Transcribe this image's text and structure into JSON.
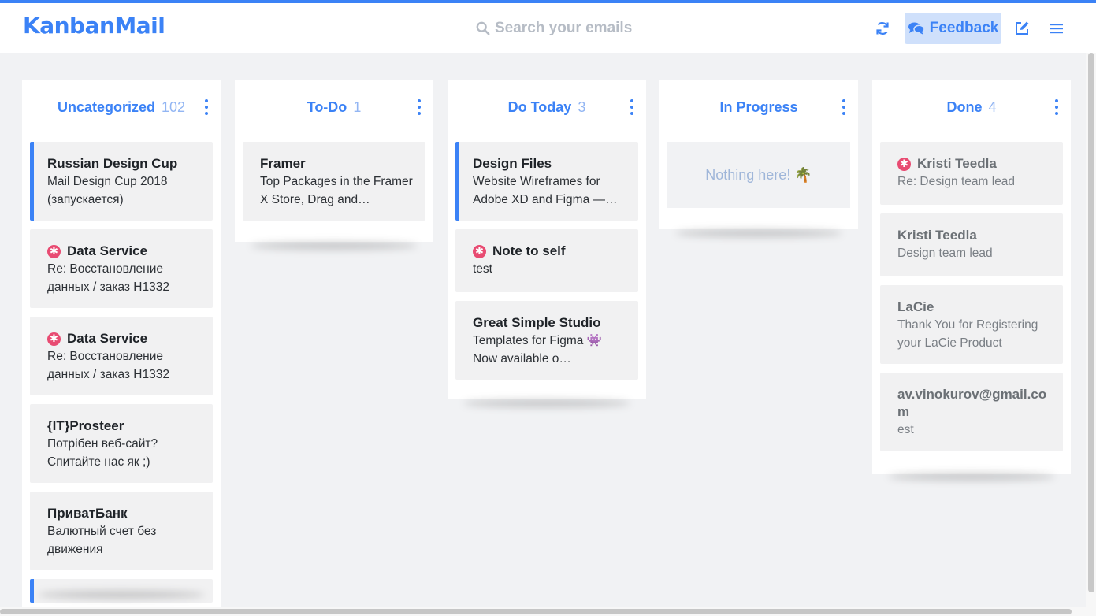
{
  "app": {
    "name": "KanbanMail",
    "accent_color": "#3b82f6"
  },
  "header": {
    "search_placeholder": "Search your emails",
    "feedback_label": "Feedback",
    "refresh_icon": "refresh-icon",
    "compose_icon": "compose-icon",
    "menu_icon": "hamburger-icon"
  },
  "columns": [
    {
      "title": "Uncategorized",
      "count": "102",
      "cards": [
        {
          "sender": "Russian Design Cup",
          "preview": "Mail Design Cup 2018 (запускается)",
          "important": false,
          "accent": true
        },
        {
          "sender": "Data Service",
          "preview": "Re: Восстановление данных / заказ H1332",
          "important": true,
          "accent": false
        },
        {
          "sender": "Data Service",
          "preview": "Re: Восстановление данных / заказ H1332",
          "important": true,
          "accent": false
        },
        {
          "sender": "{IT}Prosteer",
          "preview": "Потрібен веб-сайт? Спитайте нас як ;)",
          "important": false,
          "accent": false
        },
        {
          "sender": "ПриватБанк",
          "preview": "Валютный счет без движения",
          "important": false,
          "accent": false
        }
      ]
    },
    {
      "title": "To-Do",
      "count": "1",
      "cards": [
        {
          "sender": "Framer",
          "preview": "Top Packages in the Framer X Store, Drag and…",
          "important": false,
          "accent": false
        }
      ]
    },
    {
      "title": "Do Today",
      "count": "3",
      "cards": [
        {
          "sender": "Design Files",
          "preview": "Website Wireframes for Adobe XD and Figma —…",
          "important": false,
          "accent": true
        },
        {
          "sender": "Note to self",
          "preview": "test",
          "important": true,
          "accent": false
        },
        {
          "sender": "Great Simple Studio",
          "preview": "Templates for Figma 👾 Now available o…",
          "important": false,
          "accent": false
        }
      ]
    },
    {
      "title": "In Progress",
      "count": "",
      "empty_text": "Nothing here! 🌴",
      "cards": []
    },
    {
      "title": "Done",
      "count": "4",
      "cards": [
        {
          "sender": "Kristi Teedla",
          "preview": "Re: Design team lead",
          "important": true,
          "accent": false
        },
        {
          "sender": "Kristi Teedla",
          "preview": "Design team lead",
          "important": false,
          "accent": false
        },
        {
          "sender": "LaCie",
          "preview": "Thank You for Registering your LaCie Product",
          "important": false,
          "accent": false
        },
        {
          "sender": "av.vinokurov@gmail.co m",
          "preview": "est",
          "important": false,
          "accent": false
        }
      ]
    }
  ]
}
